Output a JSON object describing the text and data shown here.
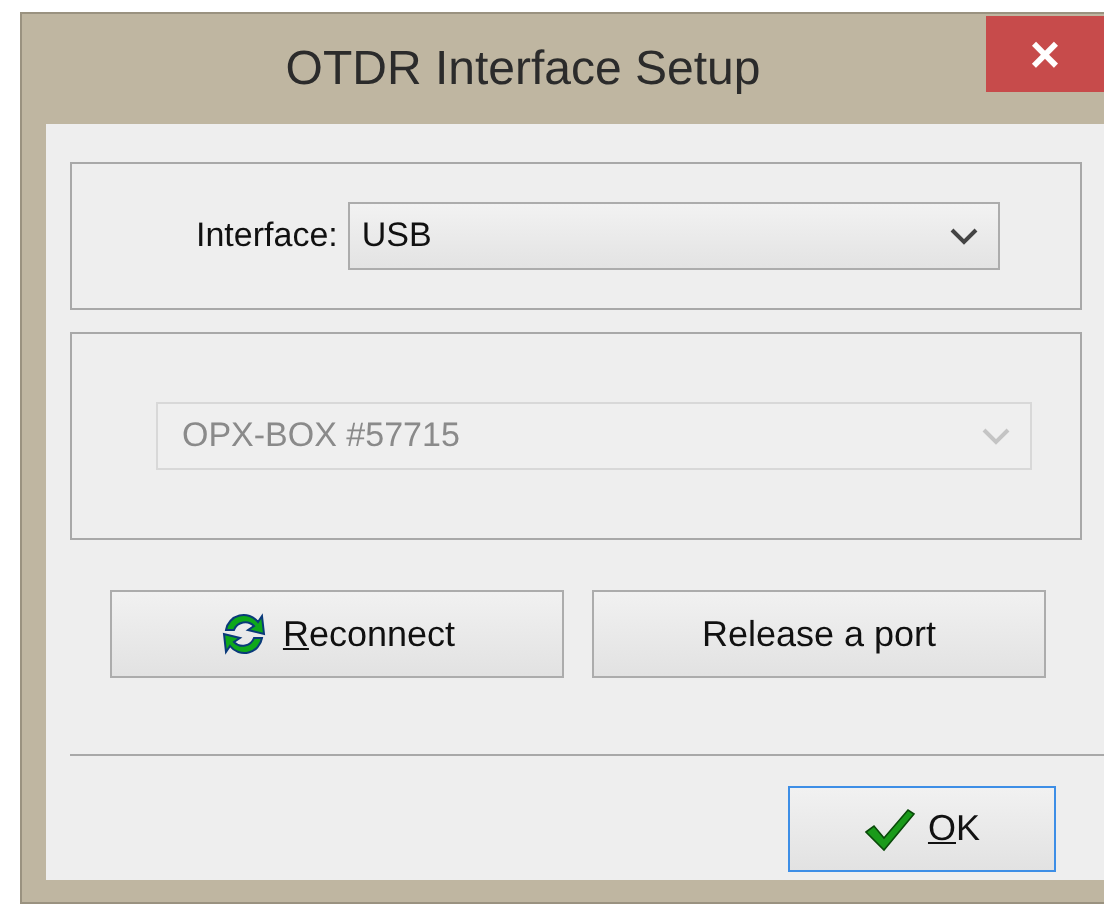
{
  "window": {
    "title": "OTDR Interface Setup",
    "close": "×"
  },
  "interface": {
    "label": "Interface:",
    "value": "USB",
    "disabled": false
  },
  "device": {
    "value": "OPX-BOX #57715",
    "disabled": true
  },
  "buttons": [
    {
      "kind": "reconnect",
      "underlined": "R",
      "rest": "econnect",
      "default": false
    },
    {
      "kind": "plain",
      "rest": "Release a port",
      "default": false
    }
  ],
  "ok_button": {
    "kind": "ok",
    "underlined": "O",
    "rest": "K",
    "default": true
  }
}
